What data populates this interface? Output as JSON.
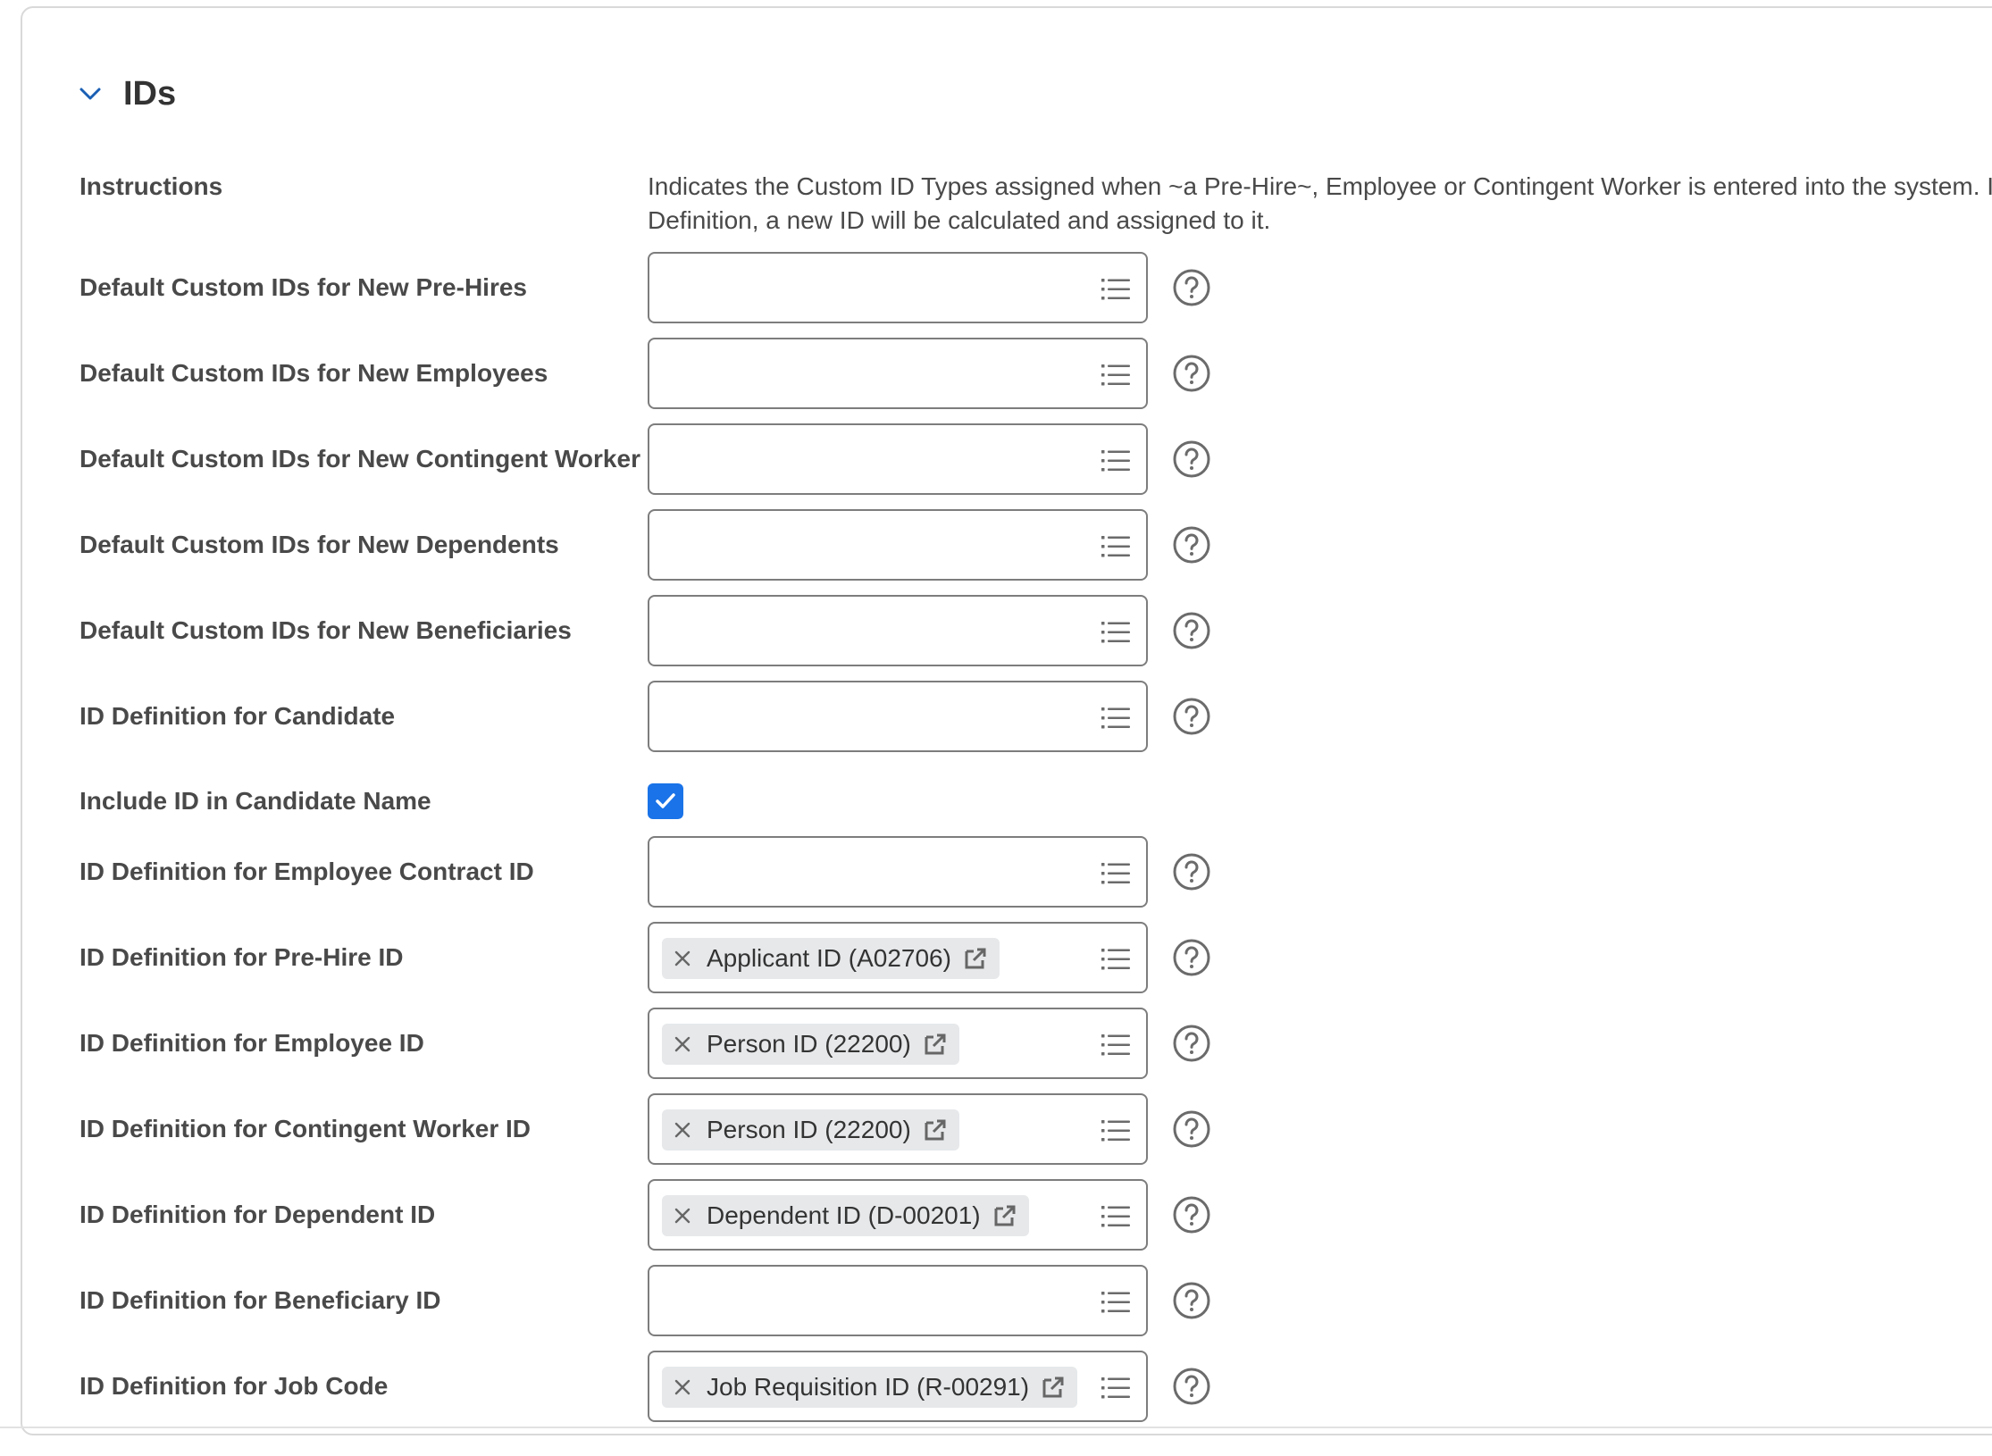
{
  "section": {
    "title": "IDs"
  },
  "instructions": {
    "label": "Instructions",
    "line1": "Indicates the Custom ID Types assigned when ~a Pre-Hire~, Employee or Contingent Worker is entered into the system. If",
    "line2": "Definition, a new ID will be calculated and assigned to it."
  },
  "fields": [
    {
      "label": "Default Custom IDs for New Pre-Hires",
      "value": ""
    },
    {
      "label": "Default Custom IDs for New Employees",
      "value": ""
    },
    {
      "label": "Default Custom IDs for New Contingent Worker",
      "value": ""
    },
    {
      "label": "Default Custom IDs for New Dependents",
      "value": ""
    },
    {
      "label": "Default Custom IDs for New Beneficiaries",
      "value": ""
    },
    {
      "label": "ID Definition for Candidate",
      "value": ""
    },
    {
      "label": "Include ID in Candidate Name",
      "checked": true
    },
    {
      "label": "ID Definition for Employee Contract ID",
      "value": ""
    },
    {
      "label": "ID Definition for Pre-Hire ID",
      "value": "Applicant ID (A02706)"
    },
    {
      "label": "ID Definition for Employee ID",
      "value": "Person ID (22200)"
    },
    {
      "label": "ID Definition for Contingent Worker ID",
      "value": "Person ID (22200)"
    },
    {
      "label": "ID Definition for Dependent ID",
      "value": "Dependent ID (D-00201)"
    },
    {
      "label": "ID Definition for Beneficiary ID",
      "value": ""
    },
    {
      "label": "ID Definition for Job Code",
      "value": "Job Requisition ID (R-00291)"
    }
  ],
  "colors": {
    "accent": "#1a73e8",
    "label": "#494949",
    "border": "#7d7d7d",
    "pill": "#e6e8ea"
  },
  "icons": [
    "chevron-down-icon",
    "prompt-list-icon",
    "help-icon",
    "remove-x-icon",
    "external-link-icon",
    "check-icon"
  ]
}
